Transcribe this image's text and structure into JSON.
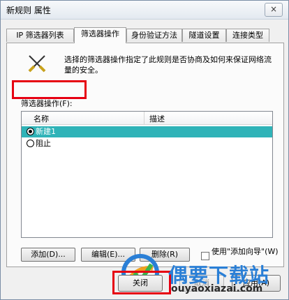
{
  "window": {
    "title": "新规则 属性",
    "close_glyph": "×"
  },
  "tabs": [
    {
      "label": "IP 筛选器列表"
    },
    {
      "label": "筛选器操作",
      "active": true
    },
    {
      "label": "身份验证方法"
    },
    {
      "label": "隧道设置"
    },
    {
      "label": "连接类型"
    }
  ],
  "panel": {
    "icon": "filter-action-icon",
    "description": "选择的筛选器操作指定了此规则是否协商及如何来保证网络流量的安全。",
    "ops_label": "筛选器操作(F):",
    "columns": [
      "名称",
      "描述"
    ],
    "rows": [
      {
        "name": "新建1",
        "selected": true
      },
      {
        "name": "阻止",
        "selected": false
      }
    ],
    "buttons": {
      "add": "添加(D)...",
      "edit": "编辑(E)...",
      "delete": "删除(R)"
    },
    "wizard_label": "使用\"添加向导\"(W)"
  },
  "footer": {
    "close": "关闭",
    "cancel": "取消",
    "apply": "应用(A)"
  },
  "watermark": {
    "brand": "偶要下载站",
    "url": "ouyaoxiazai.com"
  },
  "colors": {
    "selection": "#2fb3b8",
    "highlight_box": "#e60012",
    "brand_blue": "#2a7fd6"
  }
}
